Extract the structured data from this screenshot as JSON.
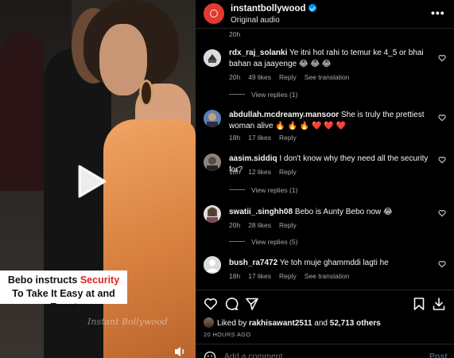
{
  "video": {
    "caption_part1": "Bebo instructs ",
    "caption_highlight": "Security",
    "caption_part2": " To Take It Easy at and Event",
    "watermark": "Instant Bollywood",
    "play_icon": "play-icon",
    "mute_icon": "speaker-icon"
  },
  "header": {
    "username": "instantbollywood",
    "subtitle": "Original audio",
    "more_label": "•••"
  },
  "top_time": "20h",
  "comments": [
    {
      "username": "rdx_raj_solanki",
      "text": "Ye itni hot rahi to temur ke 4_5 or bhai bahan aa jaayenge 😂 😂 😂",
      "time": "20h",
      "likes": "49 likes",
      "reply": "Reply",
      "translation": "See translation",
      "view_replies": "View replies (1)"
    },
    {
      "username": "abdullah.mcdreamy.mansoor",
      "text": "She is truly the prettiest woman alive 🔥 🔥 🔥 ❤️ ❤️ ❤️",
      "time": "18h",
      "likes": "17 likes",
      "reply": "Reply"
    },
    {
      "username": "aasim.siddiq",
      "text": "I don't know why they need all the security for?",
      "time": "18h",
      "likes": "12 likes",
      "reply": "Reply",
      "view_replies": "View replies (1)"
    },
    {
      "username": "swatii_.singhh08",
      "text": "Bebo is Aunty Bebo now 😂",
      "time": "20h",
      "likes": "28 likes",
      "reply": "Reply",
      "view_replies": "View replies (5)"
    },
    {
      "username": "bush_ra7472",
      "text": "Ye toh muje ghammddi lagti he",
      "time": "18h",
      "likes": "17 likes",
      "reply": "Reply",
      "translation": "See translation"
    }
  ],
  "likes": {
    "prefix": "Liked by ",
    "user": "rakhisawant2511",
    "middle": " and ",
    "count": "52,713 others"
  },
  "time_ago": "20 HOURS AGO",
  "composer": {
    "placeholder": "Add a comment…",
    "post_label": "Post"
  },
  "colors": {
    "accent_red": "#e23a2e",
    "verified_blue": "#0095f6",
    "caption_highlight": "#e0241c"
  }
}
